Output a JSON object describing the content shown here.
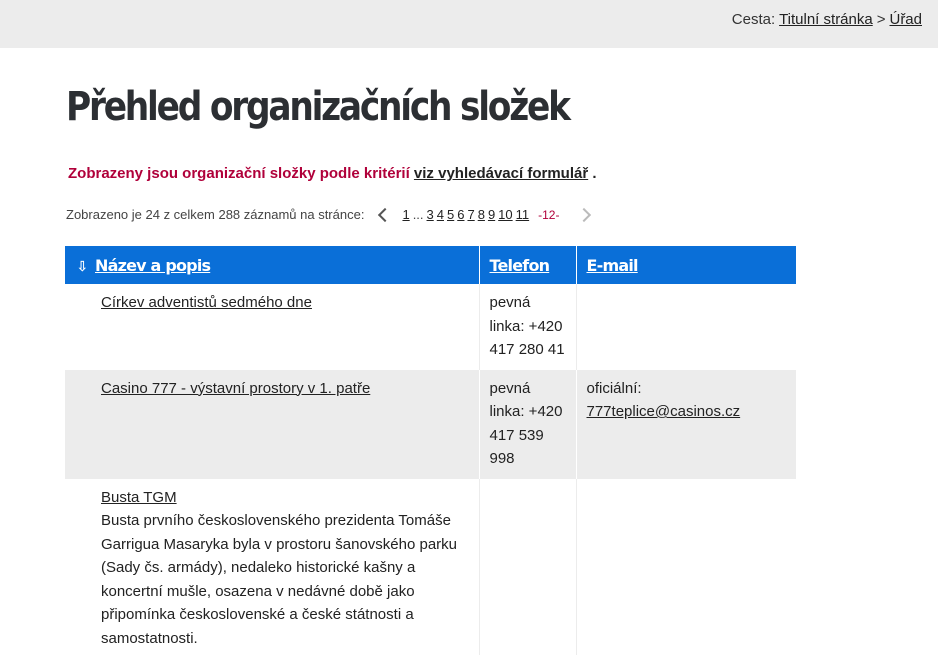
{
  "breadcrumb": {
    "prefix": "Cesta:",
    "items": [
      "Titulní stránka",
      "Úřad"
    ],
    "separator": ">"
  },
  "page_title": "Přehled organizačních složek",
  "criteria": {
    "text": "Zobrazeny jsou organizační složky podle kritérií",
    "link": "viz vyhledávací formulář",
    "end": "."
  },
  "pager": {
    "summary": "Zobrazeno je 24 z celkem 288 záznamů na stránce:",
    "pages": [
      "1",
      "...",
      "3",
      "4",
      "5",
      "6",
      "7",
      "8",
      "9",
      "10",
      "11"
    ],
    "current": "-12-"
  },
  "table": {
    "columns": [
      "Název a popis",
      "Telefon",
      "E-mail"
    ],
    "rows": [
      {
        "name": "Církev adventistů sedmého dne",
        "description": "",
        "phone": "pevná linka: +420 417 280 41",
        "email_label": "",
        "email": ""
      },
      {
        "name": "Casino 777 - výstavní prostory v 1. patře",
        "description": "",
        "phone": "pevná linka: +420 417 539 998",
        "email_label": "oficiální:",
        "email": "777teplice@casinos.cz"
      },
      {
        "name": "Busta TGM",
        "description": "Busta prvního československého prezidenta Tomáše Garrigua Masaryka byla v prostoru šanovského parku (Sady čs. armády), nedaleko historické kašny a koncertní mušle, osazena v nedávné době jako připomínka československé a české státnosti a samostatnosti.",
        "phone": "",
        "email_label": "",
        "email": ""
      }
    ]
  },
  "icons": {
    "sort": "sort-down-icon",
    "prev": "chevron-left-icon",
    "next": "chevron-right-icon"
  },
  "colors": {
    "header_bg": "#0a6fd8",
    "accent_red": "#b0003a",
    "stripe": "#ececec"
  }
}
